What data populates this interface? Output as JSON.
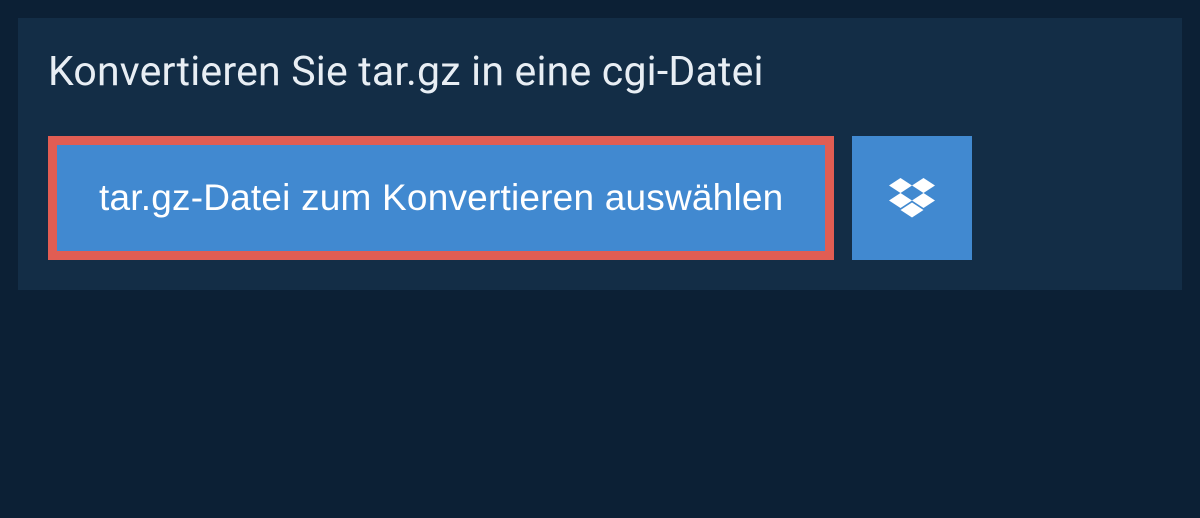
{
  "panel": {
    "heading": "Konvertieren Sie tar.gz in eine cgi-Datei",
    "select_button_label": "tar.gz-Datei zum Konvertieren auswählen"
  },
  "colors": {
    "page_bg": "#0c2035",
    "panel_bg": "#132d46",
    "button_bg": "#4189d0",
    "highlight_border": "#e15d53",
    "text_light": "#e8eef4"
  },
  "icons": {
    "dropbox": "dropbox-icon"
  }
}
